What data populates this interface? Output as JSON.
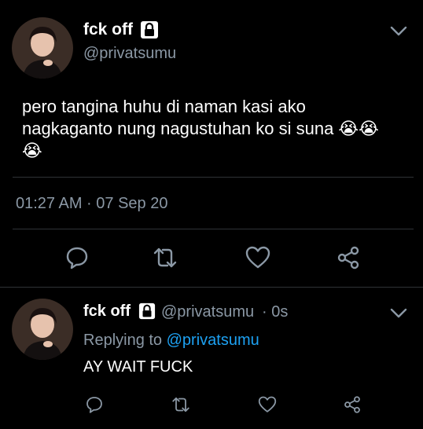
{
  "main_tweet": {
    "display_name": "fck off",
    "handle": "@privatsumu",
    "text": "pero tangina huhu di naman kasi ako nagkaganto nung nagustuhan ko si suna 😭😭😭",
    "timestamp": "01:27 AM · 07 Sep 20"
  },
  "reply_tweet": {
    "display_name": "fck off",
    "handle": "@privatsumu",
    "time": "· 0s",
    "replying_prefix": "Replying to",
    "replying_to": "@privatsumu",
    "text": "AY WAIT FUCK"
  },
  "icons": {
    "lock": "lock-icon",
    "chevron": "chevron-down-icon",
    "reply": "reply-icon",
    "retweet": "retweet-icon",
    "like": "like-icon",
    "share": "share-icon"
  },
  "colors": {
    "background": "#000000",
    "secondary_text": "#8b98a5",
    "link": "#1da1f2",
    "divider": "#2f3336"
  }
}
